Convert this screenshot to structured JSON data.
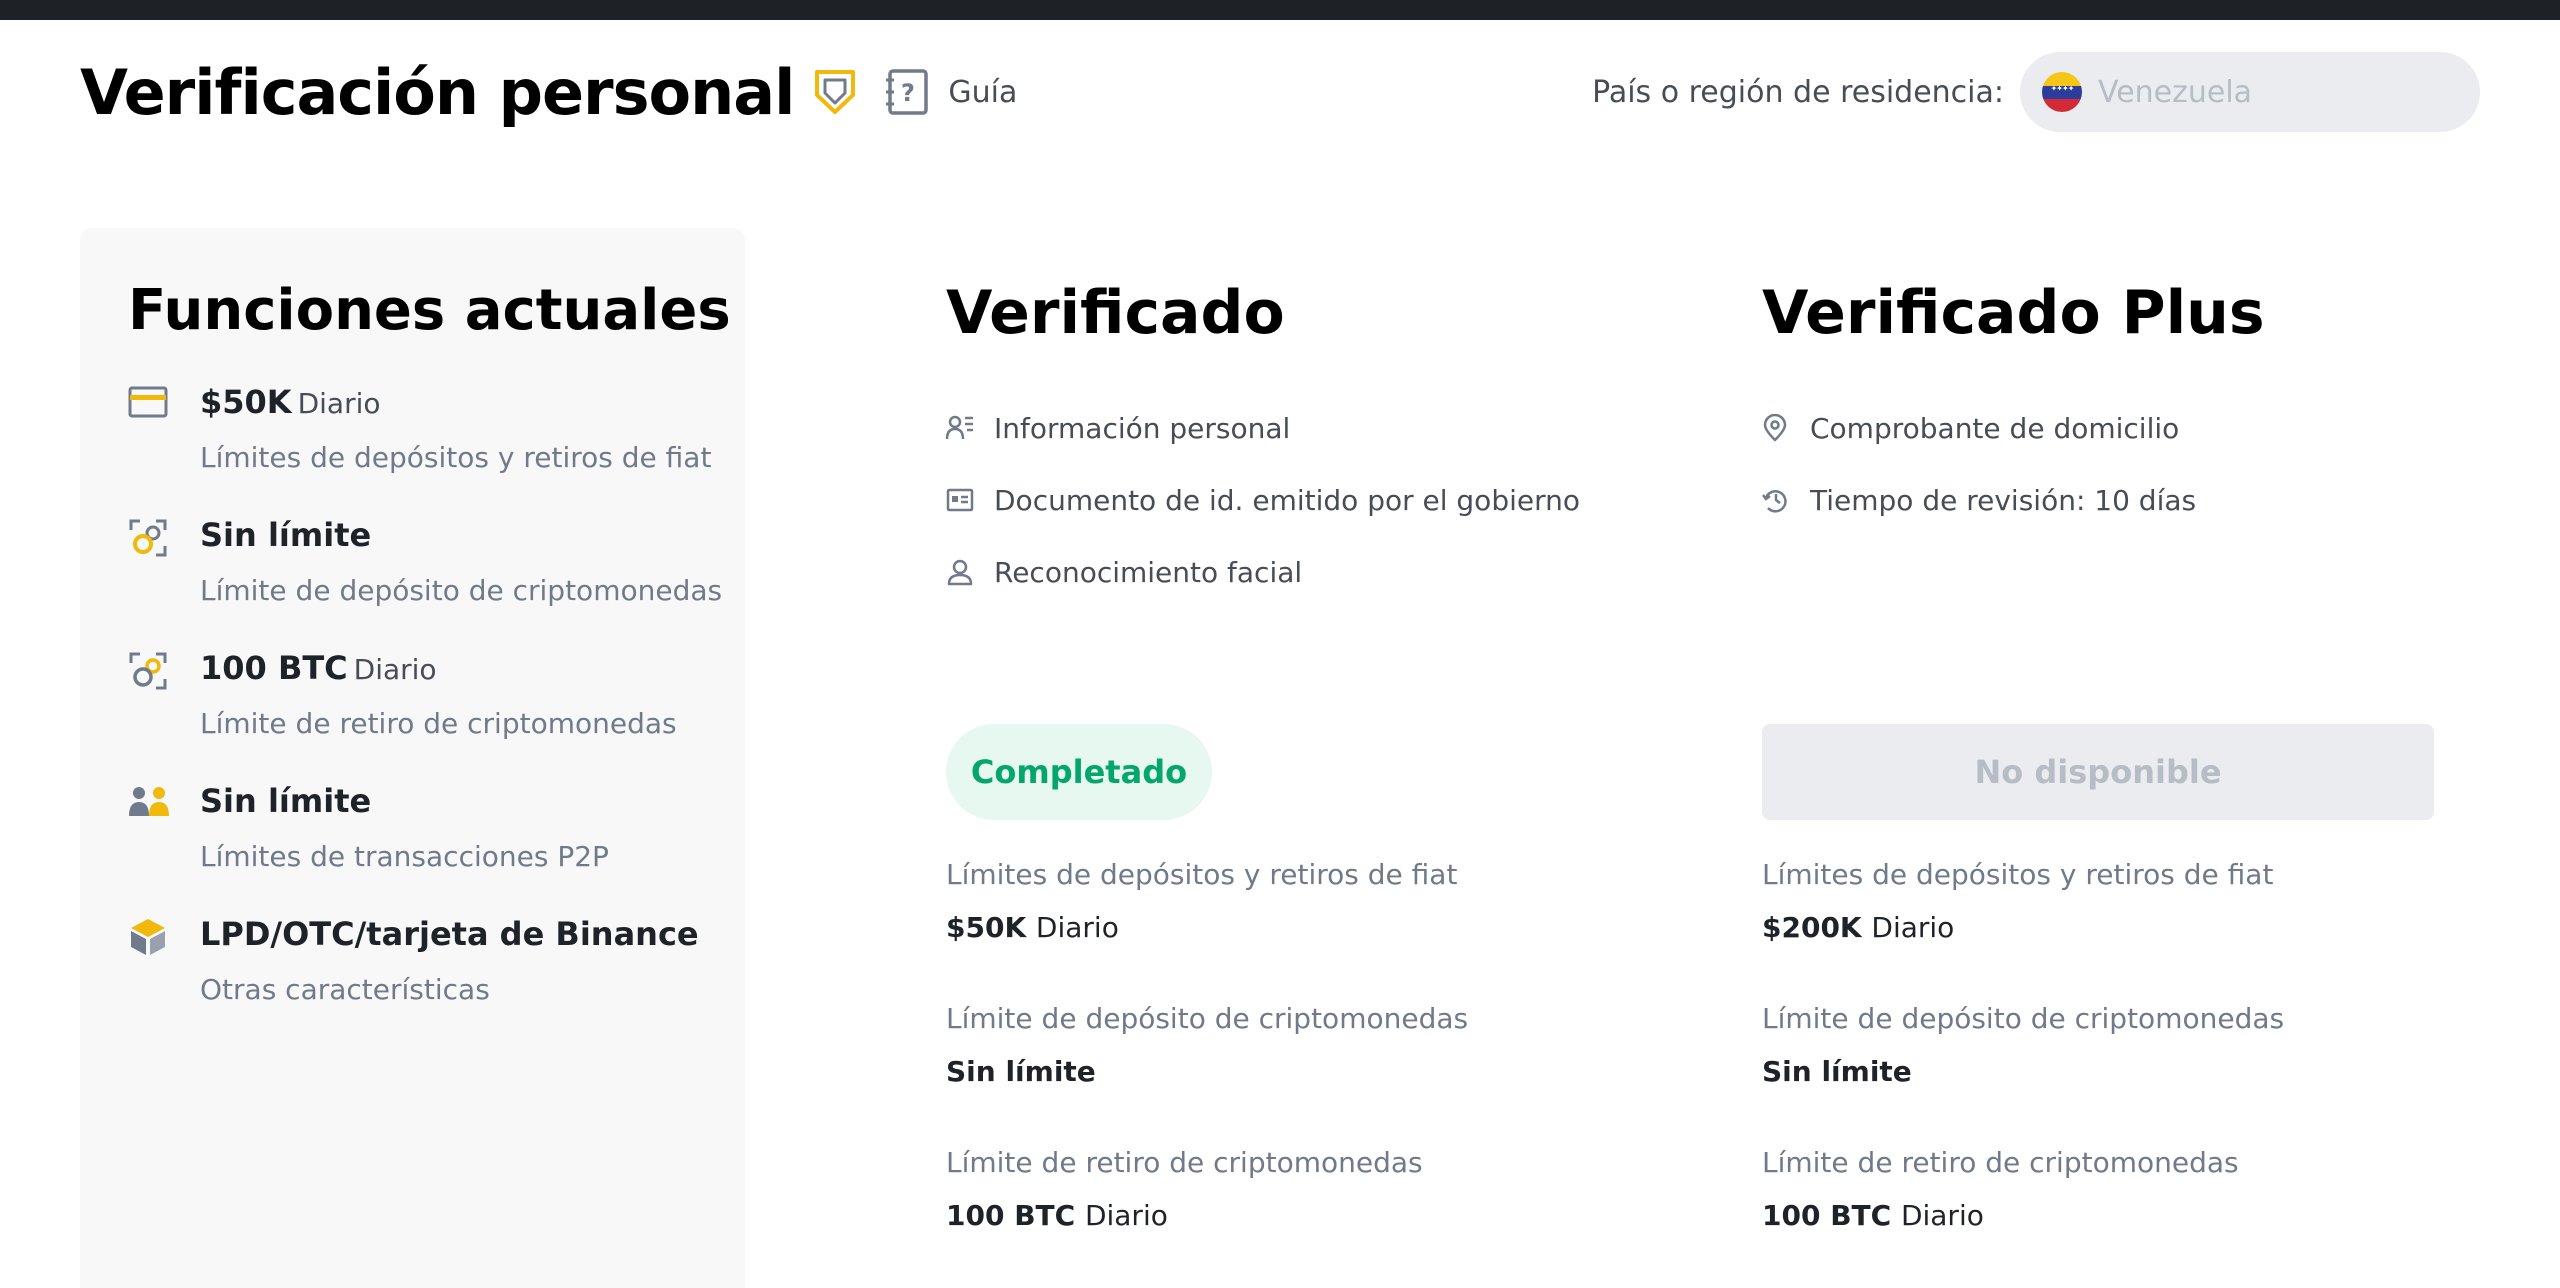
{
  "header": {
    "title": "Verificación personal",
    "guide_label": "Guía",
    "residence_label": "País o región de residencia:",
    "country": "Venezuela"
  },
  "current_features": {
    "title": "Funciones actuales",
    "items": [
      {
        "icon": "card-icon",
        "value": "$50K",
        "unit": "Diario",
        "desc": "Límites de depósitos y retiros de fiat"
      },
      {
        "icon": "crypto-deposit-icon",
        "value": "Sin límite",
        "unit": "",
        "desc": "Límite de depósito de criptomonedas"
      },
      {
        "icon": "crypto-withdraw-icon",
        "value": "100 BTC",
        "unit": "Diario",
        "desc": "Límite de retiro de criptomonedas"
      },
      {
        "icon": "p2p-users-icon",
        "value": "Sin límite",
        "unit": "",
        "desc": "Límites de transacciones P2P"
      },
      {
        "icon": "binance-box-icon",
        "value": "LPD/OTC/tarjeta de Binance",
        "unit": "",
        "desc": "Otras características"
      }
    ]
  },
  "tiers": {
    "verified": {
      "title": "Verificado",
      "requirements": [
        {
          "icon": "personal-info-icon",
          "label": "Información personal"
        },
        {
          "icon": "id-card-icon",
          "label": "Documento de id. emitido por el gobierno"
        },
        {
          "icon": "face-icon",
          "label": "Reconocimiento facial"
        }
      ],
      "status": "Completado",
      "limits": [
        {
          "label": "Límites de depósitos y retiros de fiat",
          "value": "$50K",
          "unit": "Diario"
        },
        {
          "label": "Límite de depósito de criptomonedas",
          "value": "Sin límite",
          "unit": ""
        },
        {
          "label": "Límite de retiro de criptomonedas",
          "value": "100 BTC",
          "unit": "Diario"
        }
      ]
    },
    "plus": {
      "title": "Verificado Plus",
      "requirements": [
        {
          "icon": "location-pin-icon",
          "label": "Comprobante de domicilio"
        },
        {
          "icon": "review-time-icon",
          "label": "Tiempo de revisión: 10 días"
        }
      ],
      "status": "No disponible",
      "limits": [
        {
          "label": "Límites de depósitos y retiros de fiat",
          "value": "$200K",
          "unit": "Diario"
        },
        {
          "label": "Límite de depósito de criptomonedas",
          "value": "Sin límite",
          "unit": ""
        },
        {
          "label": "Límite de retiro de criptomonedas",
          "value": "100 BTC",
          "unit": "Diario"
        }
      ]
    }
  },
  "colors": {
    "accent_yellow": "#f0b90b",
    "success_green": "#03a66d",
    "success_bg": "#e6f8f0",
    "disabled_bg": "#eaecef",
    "disabled_text": "#b7bdc6"
  }
}
